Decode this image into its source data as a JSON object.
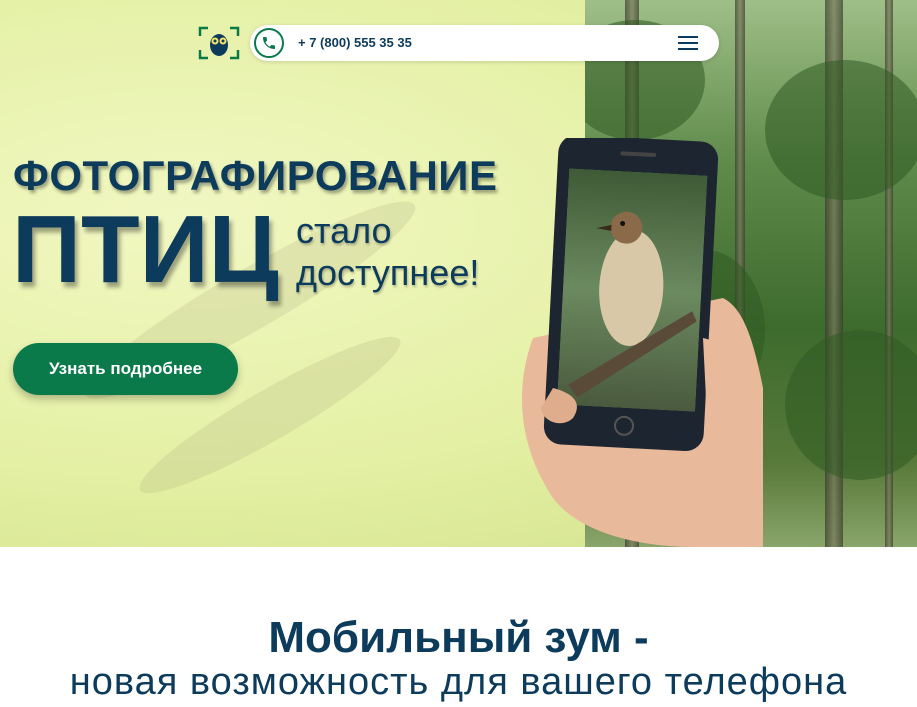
{
  "header": {
    "phone_number": "+ 7 (800) 555 35 35",
    "icons": [
      "owl-logo-icon",
      "phone-icon",
      "menu-icon"
    ]
  },
  "hero": {
    "line1": "ФОТОГРАФИРОВАНИЕ",
    "line2": "ПТИЦ",
    "line3a": "стало",
    "line3b": "доступнее!",
    "cta_label": "Узнать подробнее"
  },
  "section": {
    "title": "Мобильный зум -",
    "subtitle": "новая возможность для вашего телефона"
  },
  "colors": {
    "brand_dark": "#0d3b5c",
    "brand_green": "#0b7a4b",
    "hero_bg": "#e4f0a4"
  }
}
